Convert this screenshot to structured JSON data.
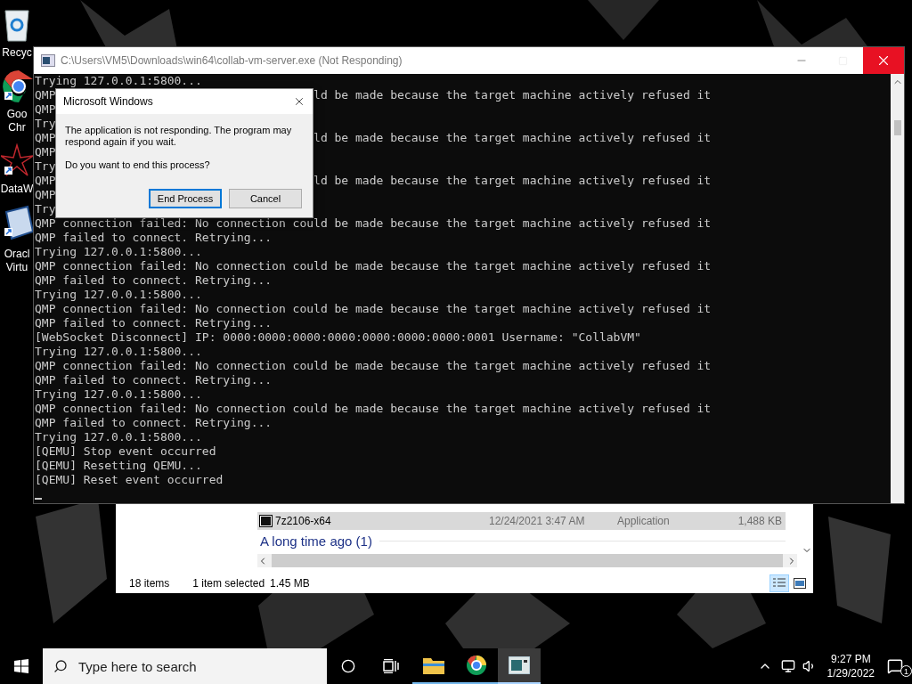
{
  "desktop_icons": [
    {
      "kind": "recycle",
      "label": "Recyc"
    },
    {
      "kind": "chrome",
      "label": "Goo Chr"
    },
    {
      "kind": "star",
      "label": "DataW"
    },
    {
      "kind": "vbox",
      "label": "Oracl Virtu"
    }
  ],
  "console": {
    "title": "C:\\Users\\VM5\\Downloads\\win64\\collab-vm-server.exe (Not Responding)",
    "maximize_enabled": false,
    "lines": [
      {
        "kind": "text",
        "text": "Trying 127.0.0.1:5800..."
      },
      {
        "kind": "split",
        "left": "QMP",
        "right": "ld be made because the target machine actively refused it"
      },
      {
        "kind": "text",
        "text": "QMP"
      },
      {
        "kind": "text",
        "text": "Try"
      },
      {
        "kind": "split",
        "left": "QMP",
        "right": "ld be made because the target machine actively refused it"
      },
      {
        "kind": "text",
        "text": "QMP"
      },
      {
        "kind": "text",
        "text": "Try"
      },
      {
        "kind": "split",
        "left": "QMP",
        "right": "ld be made because the target machine actively refused it"
      },
      {
        "kind": "text",
        "text": "QMP"
      },
      {
        "kind": "text",
        "text": "Try"
      },
      {
        "kind": "text",
        "text": "QMP connection failed: No connection could be made because the target machine actively refused it"
      },
      {
        "kind": "text",
        "text": "QMP failed to connect. Retrying..."
      },
      {
        "kind": "text",
        "text": "Trying 127.0.0.1:5800..."
      },
      {
        "kind": "text",
        "text": "QMP connection failed: No connection could be made because the target machine actively refused it"
      },
      {
        "kind": "text",
        "text": "QMP failed to connect. Retrying..."
      },
      {
        "kind": "text",
        "text": "Trying 127.0.0.1:5800..."
      },
      {
        "kind": "text",
        "text": "QMP connection failed: No connection could be made because the target machine actively refused it"
      },
      {
        "kind": "text",
        "text": "QMP failed to connect. Retrying..."
      },
      {
        "kind": "text",
        "text": "[WebSocket Disconnect] IP: 0000:0000:0000:0000:0000:0000:0000:0001 Username: \"CollabVM\""
      },
      {
        "kind": "text",
        "text": "Trying 127.0.0.1:5800..."
      },
      {
        "kind": "text",
        "text": "QMP connection failed: No connection could be made because the target machine actively refused it"
      },
      {
        "kind": "text",
        "text": "QMP failed to connect. Retrying..."
      },
      {
        "kind": "text",
        "text": "Trying 127.0.0.1:5800..."
      },
      {
        "kind": "text",
        "text": "QMP connection failed: No connection could be made because the target machine actively refused it"
      },
      {
        "kind": "text",
        "text": "QMP failed to connect. Retrying..."
      },
      {
        "kind": "text",
        "text": "Trying 127.0.0.1:5800..."
      },
      {
        "kind": "text",
        "text": "[QEMU] Stop event occurred"
      },
      {
        "kind": "text",
        "text": "[QEMU] Resetting QEMU..."
      },
      {
        "kind": "text",
        "text": "[QEMU] Reset event occurred"
      }
    ]
  },
  "dialog": {
    "title": "Microsoft Windows",
    "message": "The application is not responding. The program may respond again if you wait.",
    "question": "Do you want to end this process?",
    "buttons": [
      {
        "label": "End Process",
        "focused": true
      },
      {
        "label": "Cancel",
        "focused": false
      }
    ]
  },
  "explorer": {
    "rows": [
      {
        "name": "7z2106-x64",
        "date": "12/24/2021 3:47 AM",
        "type": "Application",
        "size": "1,488 KB",
        "selected": true
      }
    ],
    "group": "A long time ago (1)",
    "status": {
      "items": "18 items",
      "selection": "1 item selected",
      "size": "1.45 MB"
    },
    "views": [
      {
        "kind": "details",
        "selected": true
      },
      {
        "kind": "tiles",
        "selected": false
      }
    ]
  },
  "taskbar": {
    "search": {
      "placeholder": "Type here to search"
    },
    "apps": [
      {
        "kind": "explorer",
        "selected": false
      },
      {
        "kind": "chrome",
        "selected": false
      },
      {
        "kind": "console",
        "selected": true
      }
    ],
    "time": "9:27 PM",
    "date": "1/29/2022",
    "notifications": "1"
  }
}
